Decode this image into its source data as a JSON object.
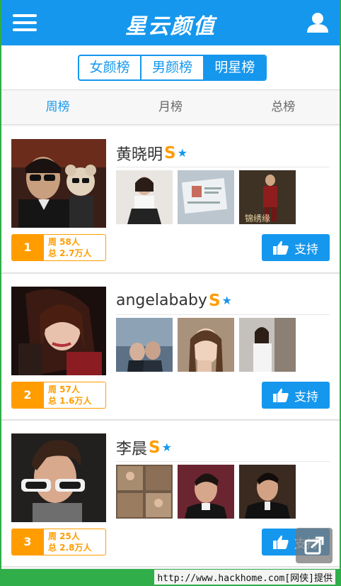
{
  "header": {
    "title": "星云颜值"
  },
  "segments": [
    "女颜榜",
    "男颜榜",
    "明星榜"
  ],
  "periods": [
    "周榜",
    "月榜",
    "总榜"
  ],
  "rankings": [
    {
      "rank": "1",
      "name": "黄晓明",
      "badge": "S",
      "week": "周 58人",
      "total": "总 2.7万人",
      "support_label": "支持"
    },
    {
      "rank": "2",
      "name": "angelababy",
      "badge": "S",
      "week": "周 57人",
      "total": "总 1.6万人",
      "support_label": "支持"
    },
    {
      "rank": "3",
      "name": "李晨",
      "badge": "S",
      "week": "周 25人",
      "total": "总 2.8万人",
      "support_label": "支持"
    }
  ],
  "thumb3_caption": "锦绣缘",
  "watermark": "http://www.hackhome.com[网侠]提供",
  "colors": {
    "primary": "#1597ee",
    "accent": "#ff9d00",
    "frame": "#2fae4a"
  },
  "icons": [
    "menu-icon",
    "user-icon",
    "thumbs-up-icon",
    "share-icon",
    "star-icon"
  ]
}
